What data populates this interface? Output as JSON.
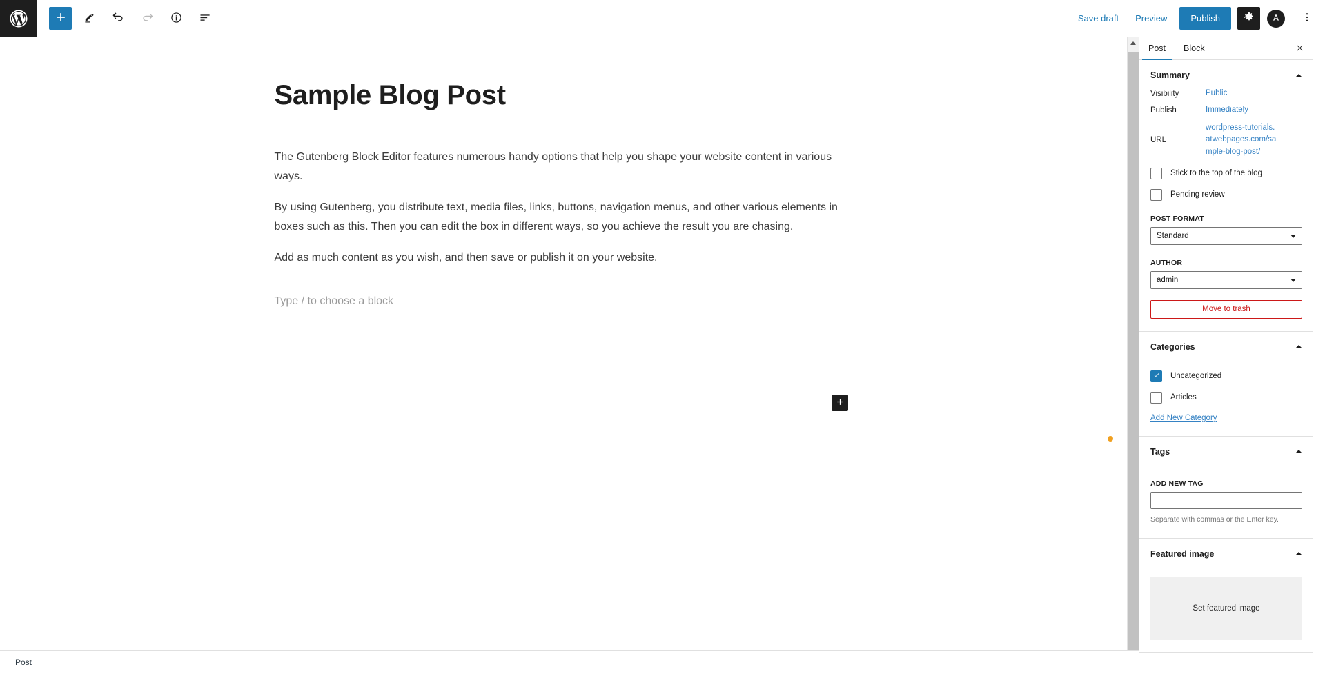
{
  "topbar": {
    "logo_icon": "wordpress-logo-icon",
    "left_tools": [
      {
        "name": "add-block-button",
        "icon": "plus-icon",
        "state": "primary"
      },
      {
        "name": "tools-button",
        "icon": "pencil-icon",
        "state": "default"
      },
      {
        "name": "undo-button",
        "icon": "undo-arrow-icon",
        "state": "default"
      },
      {
        "name": "redo-button",
        "icon": "redo-arrow-icon",
        "state": "disabled"
      },
      {
        "name": "details-button",
        "icon": "info-circle-icon",
        "state": "default"
      },
      {
        "name": "list-view-button",
        "icon": "list-view-icon",
        "state": "default"
      }
    ],
    "save_draft_label": "Save draft",
    "preview_label": "Preview",
    "publish_label": "Publish",
    "settings_icon": "gear-icon",
    "avatar_icon": "avatar-icon",
    "options_icon": "kebab-menu-icon",
    "accent_color": "#1e7bb5"
  },
  "editor": {
    "post_title": "Sample Blog Post",
    "paragraphs": [
      "The Gutenberg Block Editor features numerous handy options that help you shape your website content in various ways.",
      "By using Gutenberg, you distribute text, media files, links, buttons, navigation menus, and other various elements in boxes such as this. Then you can edit the box in different ways, so you achieve the result you are chasing.",
      "Add as much content as you wish, and then save or publish it on your website."
    ],
    "empty_block_placeholder": "Type / to choose a block",
    "floating_add_icon": "plus-icon",
    "indicator_dot_color": "#f0a020"
  },
  "bottombar": {
    "breadcrumb": "Post"
  },
  "sidebar": {
    "tabs": [
      {
        "label": "Post",
        "active": true
      },
      {
        "label": "Block",
        "active": false
      }
    ],
    "close_icon": "close-icon",
    "panels": {
      "summary": {
        "title": "Summary",
        "chevron_icon": "chevron-up-icon",
        "rows": [
          {
            "label": "Visibility",
            "value": "Public"
          },
          {
            "label": "Publish",
            "value": "Immediately"
          },
          {
            "label": "URL",
            "value": "wordpress-tutorials.atwebpages.com/sample-blog-post/"
          }
        ],
        "checkboxes": [
          {
            "label": "Stick to the top of the blog",
            "checked": false
          },
          {
            "label": "Pending review",
            "checked": false
          }
        ],
        "post_format_label": "POST FORMAT",
        "post_format_value": "Standard",
        "author_label": "AUTHOR",
        "author_value": "admin",
        "trash_label": "Move to trash",
        "trash_color": "#cc1818"
      },
      "categories": {
        "title": "Categories",
        "chevron_icon": "chevron-up-icon",
        "items": [
          {
            "label": "Uncategorized",
            "checked": true
          },
          {
            "label": "Articles",
            "checked": false
          }
        ],
        "add_new_label": "Add New Category"
      },
      "tags": {
        "title": "Tags",
        "chevron_icon": "chevron-up-icon",
        "field_label": "ADD NEW TAG",
        "field_value": "",
        "field_placeholder": "",
        "help_text": "Separate with commas or the Enter key."
      },
      "featured_image": {
        "title": "Featured image",
        "chevron_icon": "chevron-up-icon",
        "button_label": "Set featured image"
      }
    }
  }
}
